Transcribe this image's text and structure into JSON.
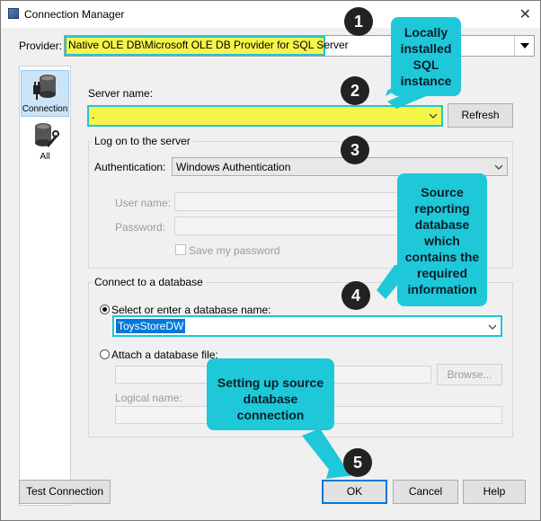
{
  "window": {
    "title": "Connection Manager",
    "close_glyph": "✕"
  },
  "provider": {
    "label": "Provider:",
    "value": "Native OLE DB\\Microsoft OLE DB Provider for SQL Server"
  },
  "sidebar": {
    "items": [
      {
        "label": "Connection"
      },
      {
        "label": "All"
      }
    ]
  },
  "server": {
    "label": "Server name:",
    "value": ".",
    "refresh": "Refresh"
  },
  "logon": {
    "title": "Log on to the server",
    "auth_label": "Authentication:",
    "auth_value": "Windows Authentication",
    "user_label": "User name:",
    "password_label": "Password:",
    "save_password": "Save my password"
  },
  "database": {
    "title": "Connect to a database",
    "select_label": "Select or enter a database name:",
    "select_value": "ToysStoreDW",
    "attach_label": "Attach a database file:",
    "browse": "Browse...",
    "logical_label": "Logical name:"
  },
  "footer": {
    "test": "Test Connection",
    "ok": "OK",
    "cancel": "Cancel",
    "help": "Help"
  },
  "annotations": {
    "numbers": [
      "1",
      "2",
      "3",
      "4",
      "5"
    ],
    "callout_1": "Locally installed SQL instance",
    "callout_2": "Source reporting database which contains the required information",
    "callout_3": "Setting up source database connection"
  },
  "colors": {
    "highlight_yellow": "#f5f54a",
    "callout_cyan": "#1ec8d8",
    "accent_blue": "#0078d7"
  }
}
